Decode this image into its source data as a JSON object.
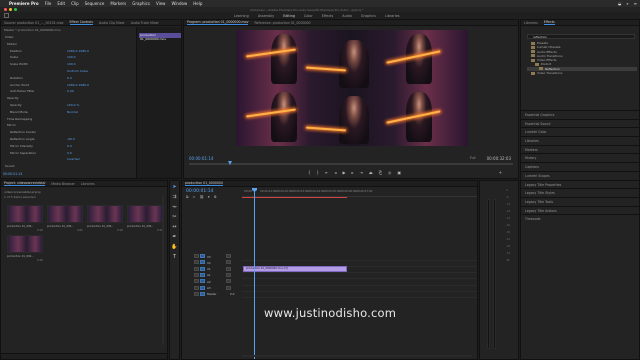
{
  "menubar": {
    "app": "Premiere Pro",
    "items": [
      "File",
      "Edit",
      "Clip",
      "Sequence",
      "Markers",
      "Graphics",
      "View",
      "Window",
      "Help"
    ]
  },
  "window": {
    "title": "/Volumes/.../Adobe Premiere Pro Auto-Save/Sh Premiere Pro Auto/.../prproj *"
  },
  "workspaces": [
    "Learning",
    "Assembly",
    "Editing",
    "Color",
    "Effects",
    "Audio",
    "Graphics",
    "Libraries"
  ],
  "workspace_active": "Editing",
  "effect_controls": {
    "tabs": [
      "Source: production 01_..._00134.mov",
      "Effect Controls",
      "Audio Clip Mixer",
      "Audio Track Mixer"
    ],
    "header": "Master * production 01_0000000.mov",
    "clip_label": "production 01_0000000.mov",
    "rows": [
      {
        "label": "Video",
        "value": ""
      },
      {
        "label": "Motion",
        "value": ""
      },
      {
        "label": "Position",
        "value": "1080.0   1080.0"
      },
      {
        "label": "Scale",
        "value": "100.0"
      },
      {
        "label": "Scale Width",
        "value": "100.0"
      },
      {
        "label": "",
        "value": "Uniform Scale"
      },
      {
        "label": "Rotation",
        "value": "0.0"
      },
      {
        "label": "Anchor Point",
        "value": "1080.0   1080.0"
      },
      {
        "label": "Anti-flicker Filter",
        "value": "0.00"
      },
      {
        "label": "Opacity",
        "value": ""
      },
      {
        "label": "Opacity",
        "value": "100.0 %"
      },
      {
        "label": "Blend Mode",
        "value": "Normal"
      },
      {
        "label": "Time Remapping",
        "value": ""
      },
      {
        "label": "Mirror",
        "value": ""
      },
      {
        "label": "Reflection Center",
        "value": ""
      },
      {
        "label": "Reflection Angle",
        "value": "-90.0"
      },
      {
        "label": "Mirror Intensity",
        "value": "0.0"
      },
      {
        "label": "Mirror Separation",
        "value": "0.0"
      },
      {
        "label": "",
        "value": "Inverted"
      },
      {
        "label": "Sound",
        "value": ""
      }
    ],
    "timecode": "00:00:01:14"
  },
  "program_monitor": {
    "tabs": [
      "Program: production 01_0000000.mov",
      "Reference: production 01_0000000"
    ],
    "timecode_left": "00:00:01:14",
    "fit": "Full",
    "timecode_right": "00:00:32:03"
  },
  "effects_panel": {
    "tabs": [
      "Libraries",
      "Effects"
    ],
    "search_value": "reflection",
    "tree": [
      {
        "label": "Presets",
        "selected": false
      },
      {
        "label": "Lumetri Presets",
        "selected": false
      },
      {
        "label": "Audio Effects",
        "selected": false
      },
      {
        "label": "Audio Transitions",
        "selected": false
      },
      {
        "label": "Video Effects",
        "selected": false
      },
      {
        "label": "Distort",
        "selected": false
      },
      {
        "label": "Reflection",
        "selected": true
      },
      {
        "label": "Video Transitions",
        "selected": false
      }
    ],
    "sections": [
      "Essential Graphics",
      "Essential Sound",
      "Lumetri Color",
      "Libraries",
      "Markers",
      "History",
      "Captions",
      "Lumetri Scopes",
      "Legacy Title Properties",
      "Legacy Title Styles",
      "Legacy Title Tools",
      "Legacy Title Actions",
      "Timecode"
    ]
  },
  "project": {
    "tabs": [
      "Project: videoconreciebtal",
      "Media Browser",
      "Libraries"
    ],
    "path": "videoconreciebtal.prproj",
    "count": "1 of 5 items selected",
    "items": [
      {
        "name": "production 01_000...",
        "dur": "3:10"
      },
      {
        "name": "production 01_000...",
        "dur": "3:01"
      },
      {
        "name": "production 01_000...",
        "dur": "3:10"
      },
      {
        "name": "production 01_000...",
        "dur": "3:10"
      },
      {
        "name": "production 01_000...",
        "dur": "3:10"
      }
    ]
  },
  "timeline": {
    "tab": "production 01_0000000",
    "timecode": "00:00:01:14",
    "ruler": [
      "00:00",
      "00:00:01:00",
      "00:00:02:00",
      "00:00:03:00",
      "00:00:04:00",
      "00:00:05:00",
      "00:00:06:00",
      "00:00:07:00"
    ],
    "tracks": [
      {
        "name": "V3",
        "type": "video"
      },
      {
        "name": "V2",
        "type": "video"
      },
      {
        "name": "V1",
        "type": "video"
      },
      {
        "name": "A1",
        "type": "audio"
      },
      {
        "name": "A2",
        "type": "audio"
      },
      {
        "name": "A3",
        "type": "audio"
      },
      {
        "name": "Master",
        "type": "audio",
        "value": "0.0"
      }
    ],
    "clip": "production 01_0000000.mov [V]"
  },
  "audio_meters": {
    "scale": [
      "0",
      "-6",
      "-12",
      "-18",
      "-24",
      "-30",
      "-36",
      "-42",
      "-48",
      "-54",
      "dB"
    ]
  },
  "watermark": "www.justinodisho.com",
  "colors": {
    "accent": "#5aa2ee",
    "clip": "#b29de6",
    "work_area": "#cc4444"
  }
}
